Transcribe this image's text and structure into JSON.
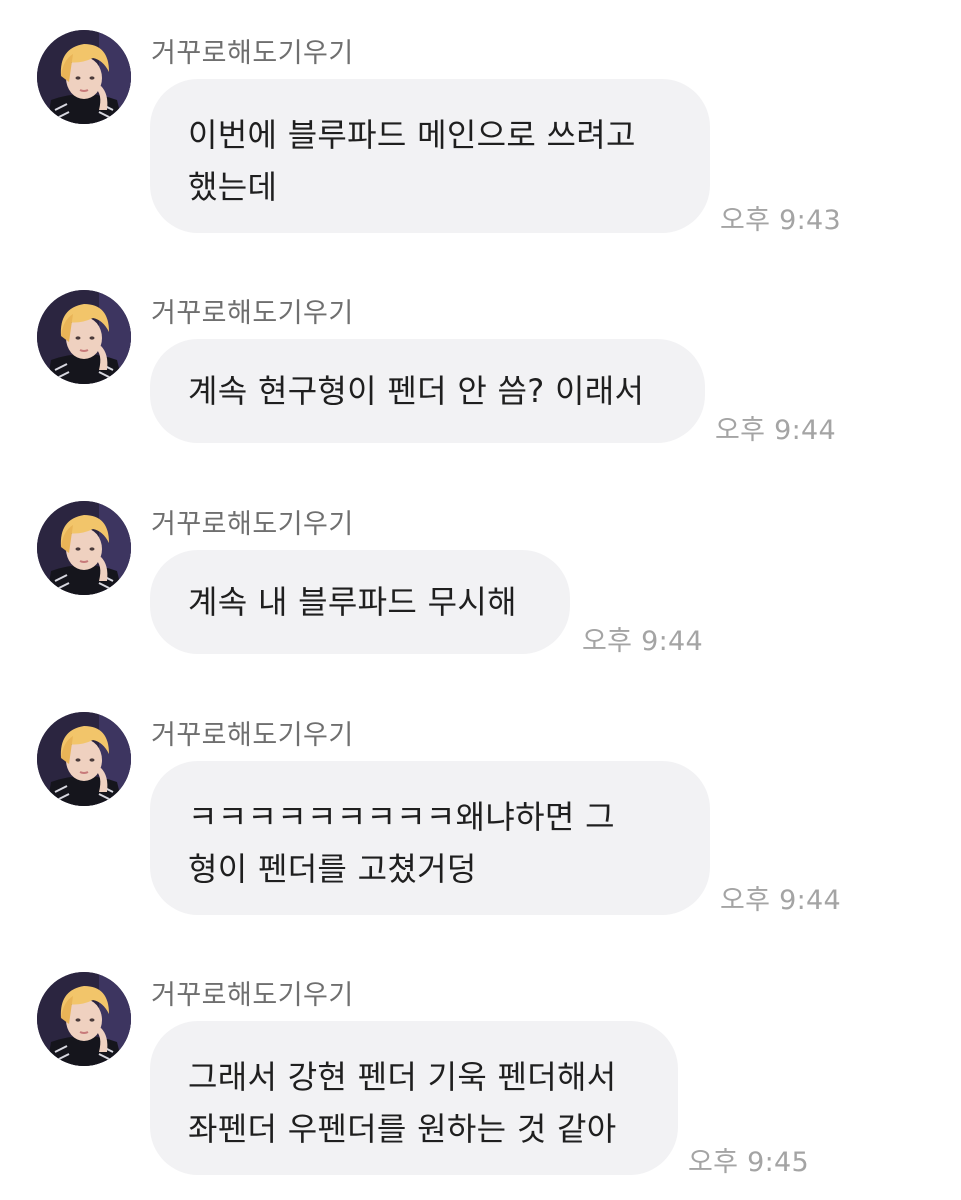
{
  "chat": {
    "messages": [
      {
        "sender": "거꾸로해도기우기",
        "avatar_icon": "profile-photo",
        "text": "이번에 블루파드 메인으로 쓰려고\n했는데",
        "time": "오후 9:43"
      },
      {
        "sender": "거꾸로해도기우기",
        "avatar_icon": "profile-photo",
        "text": "계속 현구형이 펜더 안 씀? 이래서",
        "time": "오후 9:44"
      },
      {
        "sender": "거꾸로해도기우기",
        "avatar_icon": "profile-photo",
        "text": "계속 내 블루파드 무시해",
        "time": "오후 9:44"
      },
      {
        "sender": "거꾸로해도기우기",
        "avatar_icon": "profile-photo",
        "text": "ㅋㅋㅋㅋㅋㅋㅋㅋㅋ왜냐하면 그\n형이 펜더를 고쳤거덩",
        "time": "오후 9:44"
      },
      {
        "sender": "거꾸로해도기우기",
        "avatar_icon": "profile-photo",
        "text": "그래서 강현 펜더 기욱 펜더해서\n좌펜더 우펜더를 원하는 것 같아",
        "time": "오후 9:45"
      }
    ],
    "colors": {
      "bubble_bg": "#f2f2f4",
      "sender_text": "#6f6f6f",
      "time_text": "#a4a4a4",
      "message_text": "#1f1f1f"
    }
  }
}
